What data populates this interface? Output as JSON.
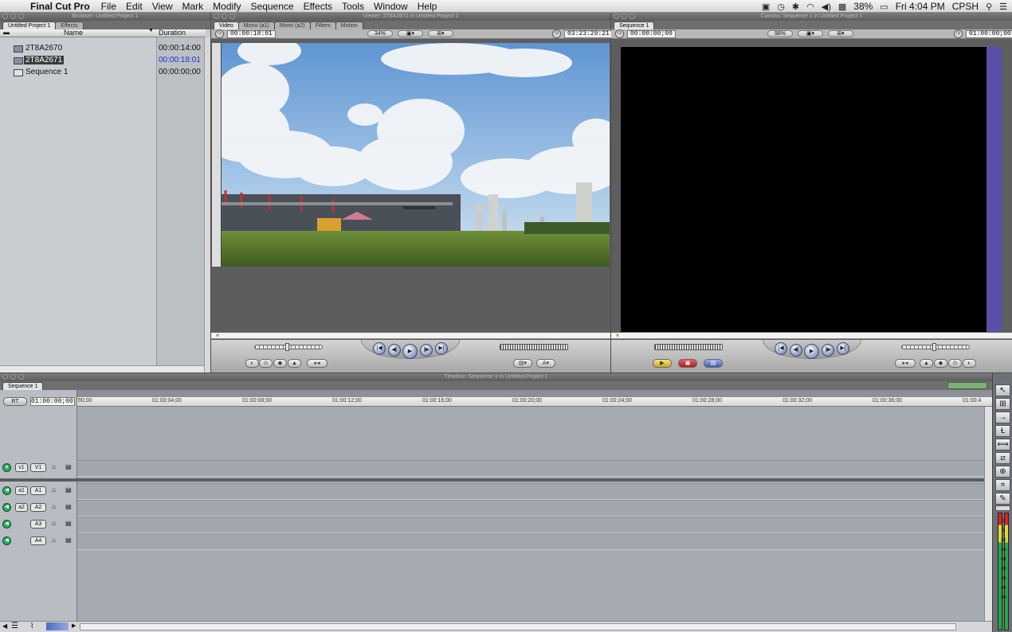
{
  "menubar": {
    "app_name": "Final Cut Pro",
    "menus": [
      "File",
      "Edit",
      "View",
      "Mark",
      "Modify",
      "Sequence",
      "Effects",
      "Tools",
      "Window",
      "Help"
    ],
    "battery": "38%",
    "clock": "Fri 4:04 PM",
    "user": "CPSH"
  },
  "browser": {
    "title": "Browser: Untitled Project 1",
    "tabs": [
      "Untitled Project 1",
      "Effects"
    ],
    "col_name": "Name",
    "col_duration": "Duration",
    "rows": [
      {
        "name": "2T8A2670",
        "duration": "00:00:14:00"
      },
      {
        "name": "2T8A2671",
        "duration": "00:00:18:01"
      },
      {
        "name": "Sequence 1",
        "duration": "00:00:00;00"
      }
    ]
  },
  "viewer": {
    "title": "Viewer: 2T8A2671 in Untitled Project 1",
    "tabs": [
      "Video",
      "Mono (a1)",
      "Mono (a2)",
      "Filters",
      "Motion"
    ],
    "timecode_left": "00:00:18:01",
    "zoom": "34%",
    "timecode_right": "03:23:29:21"
  },
  "canvas": {
    "title": "Canvas: Sequence 1 in Untitled Project 1",
    "tabs": [
      "Sequence 1"
    ],
    "timecode_left": "00:00:00;00",
    "zoom": "98%",
    "timecode_right": "01:00:00;00",
    "accent": "#5950a9"
  },
  "timeline": {
    "title": "Timeline: Sequence 1 in Untitled Project 1",
    "tabs": [
      "Sequence 1"
    ],
    "rt_label": "RT",
    "timecode": "01:00:00;00",
    "ruler": [
      "00;00",
      "01:00:04;00",
      "01:00:08;00",
      "01:00:12;00",
      "01:00:16;00",
      "01:00:20;00",
      "01:00:24;00",
      "01:00:28;00",
      "01:00:32;00",
      "01:00:36;00",
      "01:00:4"
    ],
    "tracks": [
      {
        "src": "v1",
        "dest": "V1"
      },
      {
        "src": "a1",
        "dest": "A1"
      },
      {
        "src": "a2",
        "dest": "A2"
      },
      {
        "src": "",
        "dest": "A3"
      },
      {
        "src": "",
        "dest": "A4"
      }
    ],
    "meter_ticks": [
      "0",
      "-6",
      "-12",
      "-18",
      "-24",
      "-30",
      "-36",
      "-42",
      "-48"
    ]
  }
}
